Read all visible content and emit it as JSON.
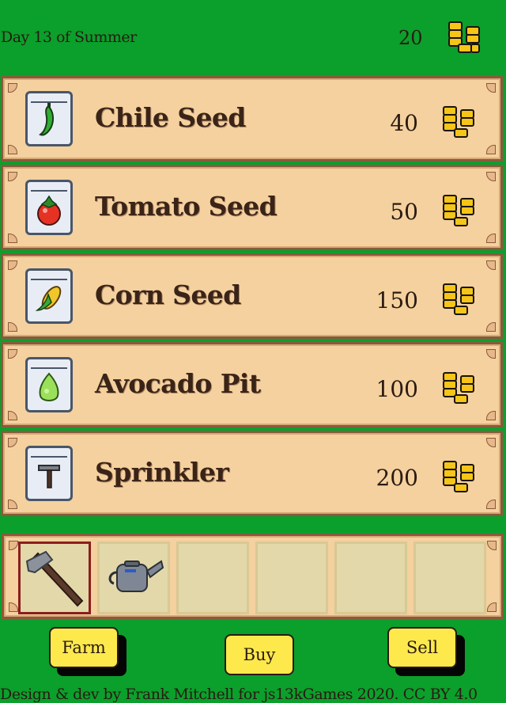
{
  "hud": {
    "day": "Day 13 of Summer",
    "gold": "20",
    "gold_icon": "gold-coin-stack-icon"
  },
  "shop": {
    "items": [
      {
        "name": "Chile Seed",
        "price": "40",
        "icon": "chile-icon"
      },
      {
        "name": "Tomato Seed",
        "price": "50",
        "icon": "tomato-icon"
      },
      {
        "name": "Corn Seed",
        "price": "150",
        "icon": "corn-icon"
      },
      {
        "name": "Avocado Pit",
        "price": "100",
        "icon": "avocado-icon"
      },
      {
        "name": "Sprinkler",
        "price": "200",
        "icon": "sprinkler-icon"
      }
    ]
  },
  "inventory": {
    "slots": [
      {
        "item": "hoe",
        "selected": true
      },
      {
        "item": "watering-can",
        "selected": false
      },
      {
        "item": "",
        "selected": false
      },
      {
        "item": "",
        "selected": false
      },
      {
        "item": "",
        "selected": false
      },
      {
        "item": "",
        "selected": false
      }
    ]
  },
  "buttons": {
    "farm": "Farm",
    "buy": "Buy",
    "sell": "Sell"
  },
  "footer": {
    "credits": "Design & dev by Frank Mitchell for js13kGames 2020. CC BY 4.0"
  },
  "colors": {
    "background": "#0b9f2c",
    "panel": "#f4d19e",
    "panel_border": "#8a5a3c",
    "button": "#fde94c",
    "selected_slot_border": "#8b1e1e"
  }
}
